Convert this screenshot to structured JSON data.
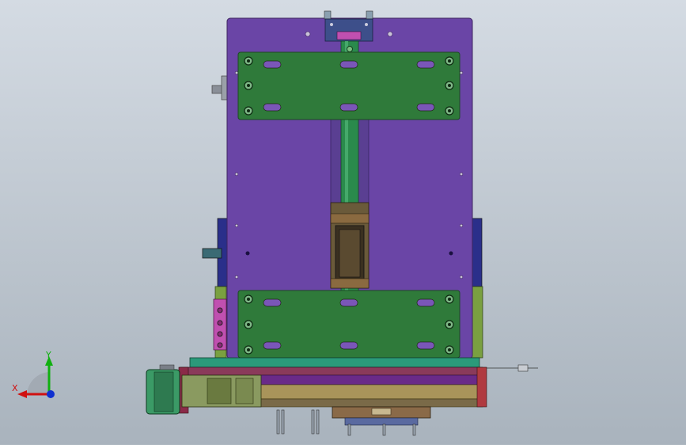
{
  "viewport": {
    "background_top": "#d4dbe3",
    "background_bottom": "#a9b3bd"
  },
  "colors": {
    "main_plate": "#6a45a6",
    "main_plate_edge": "#3e2560",
    "green_plate": "#2f7a3a",
    "green_plate_edge": "#1c4a22",
    "rail": "#2a8a4c",
    "slot": "#7a56b8",
    "carriage": "#4a3a2a",
    "base_teal": "#2b9a7a",
    "base_purple": "#6a2a88",
    "base_gold": "#a9945a",
    "motor_green": "#3b9a66",
    "side_navy": "#2a2f8a",
    "side_pink": "#c050b0",
    "side_olive": "#7aa040",
    "clamp_navy": "#3d4f8a",
    "axis_x": "#d01010",
    "axis_y": "#10b010",
    "axis_z": "#1030d0"
  },
  "triad": {
    "x_label": "X",
    "y_label": "Y"
  },
  "icons": {
    "triad": "coordinate-triad-icon",
    "screw": "screw-hole-icon"
  }
}
